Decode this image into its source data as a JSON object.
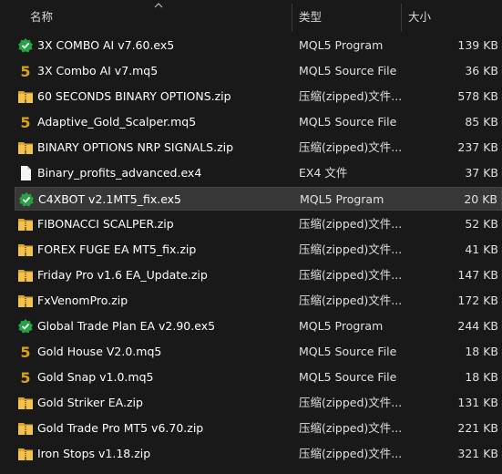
{
  "header": {
    "name_label": "名称",
    "type_label": "类型",
    "size_label": "大小"
  },
  "colors": {
    "background": "#191919",
    "selected_row": "#373737",
    "folder_zip": "#e8b63a",
    "ex5_shield": "#2aa845",
    "mq5_five": "#d4a017"
  },
  "files": [
    {
      "name": "3X COMBO AI v7.60.ex5",
      "type": "MQL5 Program",
      "size": "139 KB",
      "icon": "ex5-shield-icon"
    },
    {
      "name": "3X Combo AI v7.mq5",
      "type": "MQL5 Source File",
      "size": "36 KB",
      "icon": "mq5-five-icon"
    },
    {
      "name": "60 SECONDS BINARY OPTIONS.zip",
      "type": "压缩(zipped)文件...",
      "size": "578 KB",
      "icon": "zip-folder-icon"
    },
    {
      "name": "Adaptive_Gold_Scalper.mq5",
      "type": "MQL5 Source File",
      "size": "85 KB",
      "icon": "mq5-five-icon"
    },
    {
      "name": "BINARY OPTIONS NRP SIGNALS.zip",
      "type": "压缩(zipped)文件...",
      "size": "237 KB",
      "icon": "zip-folder-icon"
    },
    {
      "name": "Binary_profits_advanced.ex4",
      "type": "EX4 文件",
      "size": "37 KB",
      "icon": "blank-file-icon"
    },
    {
      "name": "C4XBOT v2.1MT5_fix.ex5",
      "type": "MQL5 Program",
      "size": "20 KB",
      "icon": "ex5-shield-icon",
      "selected": true
    },
    {
      "name": "FIBONACCI SCALPER.zip",
      "type": "压缩(zipped)文件...",
      "size": "52 KB",
      "icon": "zip-folder-icon"
    },
    {
      "name": "FOREX FUGE EA MT5_fix.zip",
      "type": "压缩(zipped)文件...",
      "size": "41 KB",
      "icon": "zip-folder-icon"
    },
    {
      "name": "Friday Pro v1.6 EA_Update.zip",
      "type": "压缩(zipped)文件...",
      "size": "147 KB",
      "icon": "zip-folder-icon"
    },
    {
      "name": "FxVenomPro.zip",
      "type": "压缩(zipped)文件...",
      "size": "172 KB",
      "icon": "zip-folder-icon"
    },
    {
      "name": "Global Trade Plan EA v2.90.ex5",
      "type": "MQL5 Program",
      "size": "244 KB",
      "icon": "ex5-shield-icon"
    },
    {
      "name": "Gold House V2.0.mq5",
      "type": "MQL5 Source File",
      "size": "18 KB",
      "icon": "mq5-five-icon"
    },
    {
      "name": "Gold Snap  v1.0.mq5",
      "type": "MQL5 Source File",
      "size": "18 KB",
      "icon": "mq5-five-icon"
    },
    {
      "name": "Gold Striker EA.zip",
      "type": "压缩(zipped)文件...",
      "size": "131 KB",
      "icon": "zip-folder-icon"
    },
    {
      "name": "Gold Trade Pro MT5 v6.70.zip",
      "type": "压缩(zipped)文件...",
      "size": "221 KB",
      "icon": "zip-folder-icon"
    },
    {
      "name": "Iron Stops v1.18.zip",
      "type": "压缩(zipped)文件...",
      "size": "321 KB",
      "icon": "zip-folder-icon"
    }
  ]
}
